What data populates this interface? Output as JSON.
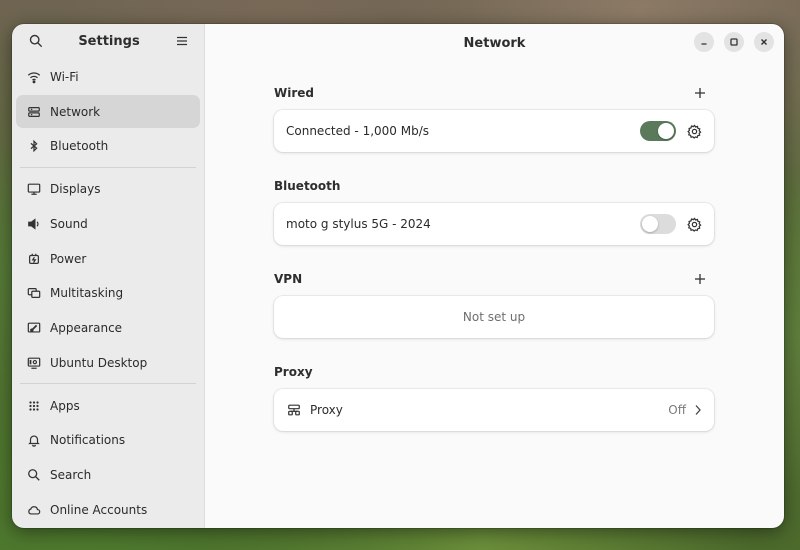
{
  "sidebar": {
    "title": "Settings",
    "items": [
      {
        "label": "Wi-Fi",
        "icon": "wifi-icon"
      },
      {
        "label": "Network",
        "icon": "network-icon",
        "active": true
      },
      {
        "label": "Bluetooth",
        "icon": "bluetooth-icon"
      },
      {
        "label": "Displays",
        "icon": "display-icon"
      },
      {
        "label": "Sound",
        "icon": "speaker-icon"
      },
      {
        "label": "Power",
        "icon": "power-icon"
      },
      {
        "label": "Multitasking",
        "icon": "multitasking-icon"
      },
      {
        "label": "Appearance",
        "icon": "appearance-icon"
      },
      {
        "label": "Ubuntu Desktop",
        "icon": "ubuntu-desktop-icon"
      },
      {
        "label": "Apps",
        "icon": "apps-icon"
      },
      {
        "label": "Notifications",
        "icon": "bell-icon"
      },
      {
        "label": "Search",
        "icon": "search-icon"
      },
      {
        "label": "Online Accounts",
        "icon": "cloud-icon"
      }
    ]
  },
  "header": {
    "title": "Network"
  },
  "wired": {
    "title": "Wired",
    "status": "Connected - 1,000 Mb/s",
    "toggle_on": true
  },
  "bluetooth": {
    "title": "Bluetooth",
    "device": "moto g stylus 5G - 2024",
    "toggle_on": false
  },
  "vpn": {
    "title": "VPN",
    "empty_text": "Not set up"
  },
  "proxy": {
    "title": "Proxy",
    "label": "Proxy",
    "value": "Off"
  },
  "colors": {
    "accent": "#5b7a5b",
    "sidebar_bg": "#ebebeb",
    "main_bg": "#fafafa"
  }
}
